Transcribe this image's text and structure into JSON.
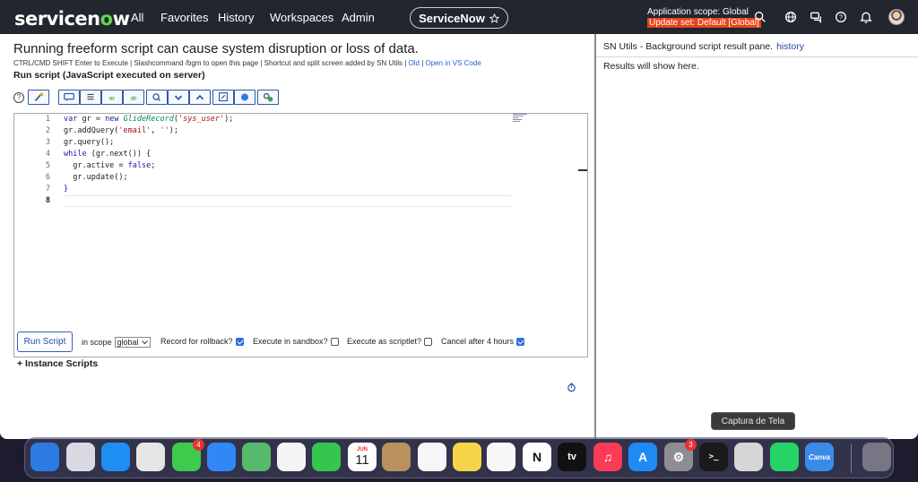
{
  "nav": {
    "logo_prefix": "servicen",
    "logo_o": "o",
    "logo_suffix": "w",
    "links": [
      "All",
      "Favorites",
      "History",
      "Workspaces",
      "Admin"
    ],
    "instance_pill": "ServiceNow",
    "scope_label": "Application scope: Global",
    "update_set": "Update set: Default [Global]"
  },
  "left": {
    "warning": "Running freeform script can cause system disruption or loss of data.",
    "hint": "CTRL/CMD SHIFT Enter to Execute | Slashcommand /bgm to open this page | Shortcut and split screen added by SN Utils | ",
    "hint_old": "Old",
    "hint_sep": " | ",
    "hint_vscode": "Open in VS Code",
    "run_label": "Run script (JavaScript executed on server)",
    "help_glyph": "?"
  },
  "editor": {
    "lines": [
      {
        "n": "1"
      },
      {
        "n": "2"
      },
      {
        "n": "3"
      },
      {
        "n": "4"
      },
      {
        "n": "5"
      },
      {
        "n": "6"
      },
      {
        "n": "7"
      },
      {
        "n": "8"
      }
    ],
    "code": {
      "l1_var": "var",
      "l1_a": " gr = ",
      "l1_new": "new",
      "l1_sp": " ",
      "l1_cls": "GlideRecord",
      "l1_p1": "(",
      "l1_str": "'sys_user'",
      "l1_p2": ");",
      "l2_a": "gr.addQuery(",
      "l2_s1": "'email'",
      "l2_b": ", ",
      "l2_s2": "''",
      "l2_c": ");",
      "l3": "gr.query();",
      "l4_while": "while",
      "l4_rest": " (gr.next()) {",
      "l5_a": "  gr.active = ",
      "l5_false": "false",
      "l5_b": ";",
      "l6": "  gr.update();",
      "l7": "}"
    }
  },
  "controls": {
    "run_button": "Run Script",
    "in_scope": "in scope",
    "scope_value": "global",
    "rollback": "Record for rollback?",
    "rollback_checked": true,
    "sandbox": "Execute in sandbox?",
    "sandbox_checked": false,
    "scriptlet": "Execute as scriptlet?",
    "scriptlet_checked": false,
    "cancel": "Cancel after 4 hours",
    "cancel_checked": true,
    "instance_scripts": "+ Instance Scripts"
  },
  "right": {
    "title": "SN Utils - Background script result pane.",
    "history_link": "history",
    "results": "Results will show here."
  },
  "tooltip": "Captura de Tela",
  "dock": {
    "items": [
      {
        "name": "finder",
        "color": "#2c7be5",
        "glyph": ""
      },
      {
        "name": "launchpad",
        "color": "#d9d9e3",
        "glyph": ""
      },
      {
        "name": "safari",
        "color": "#1d8ff2",
        "glyph": ""
      },
      {
        "name": "chrome",
        "color": "#e5e5e5",
        "glyph": ""
      },
      {
        "name": "messages",
        "color": "#3ccb4c",
        "glyph": "",
        "badge": "4"
      },
      {
        "name": "mail",
        "color": "#2f88f5",
        "glyph": ""
      },
      {
        "name": "maps",
        "color": "#58b96a",
        "glyph": ""
      },
      {
        "name": "photos",
        "color": "#f4f4f4",
        "glyph": ""
      },
      {
        "name": "facetime",
        "color": "#35c64d",
        "glyph": ""
      },
      {
        "name": "calendar",
        "color": "#ffffff",
        "glyph": "11",
        "month": "JUN"
      },
      {
        "name": "contacts",
        "color": "#b8915c",
        "glyph": ""
      },
      {
        "name": "reminders",
        "color": "#f6f6f6",
        "glyph": ""
      },
      {
        "name": "notes",
        "color": "#f5d44a",
        "glyph": ""
      },
      {
        "name": "freeform",
        "color": "#f7f7f7",
        "glyph": ""
      },
      {
        "name": "notion",
        "color": "#ffffff",
        "glyph": "N"
      },
      {
        "name": "apple-tv",
        "color": "#111111",
        "glyph": "tv"
      },
      {
        "name": "music",
        "color": "#fa3c56",
        "glyph": "♫"
      },
      {
        "name": "app-store",
        "color": "#1f8af3",
        "glyph": "A"
      },
      {
        "name": "system-settings",
        "color": "#8d8d93",
        "glyph": "⚙",
        "badge": "3"
      },
      {
        "name": "terminal",
        "color": "#1b1b1b",
        "glyph": ">_"
      },
      {
        "name": "screenshot",
        "color": "#d6d6d6",
        "glyph": ""
      },
      {
        "name": "whatsapp",
        "color": "#25d366",
        "glyph": ""
      },
      {
        "name": "canva",
        "color": "#3a8be8",
        "glyph": "Canva"
      },
      {
        "name": "trash",
        "color": "#767684",
        "glyph": ""
      }
    ]
  }
}
